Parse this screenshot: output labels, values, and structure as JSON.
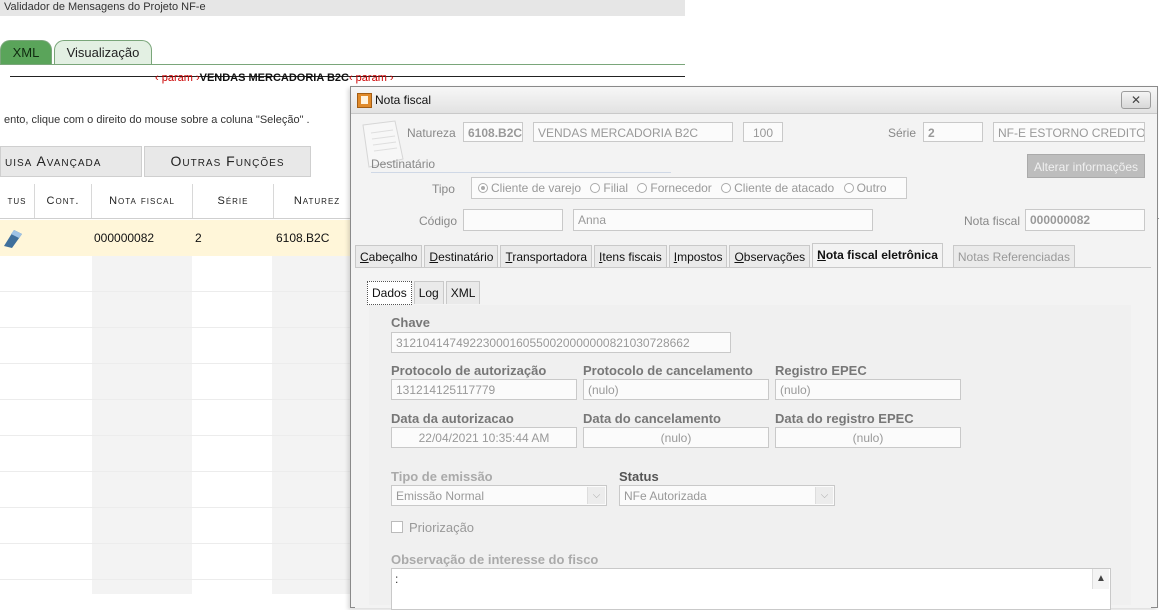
{
  "background": {
    "title": "Validador de Mensagens do Projeto NF-e",
    "tabs": [
      "XML",
      "Visualização"
    ],
    "red_text_prefix": "‹ param ›",
    "red_text_bold": "VENDAS MERCADORIA B2C",
    "red_text_suffix": "‹ param ›",
    "hint": "ento, clique com o direito do mouse sobre a coluna \"Seleção\" .",
    "buttons": {
      "advanced": "uisa Avançada",
      "other": "Outras Funções"
    },
    "columns": [
      "tus",
      "Cont.",
      "Nota fiscal",
      "Série",
      "Naturez"
    ],
    "row": {
      "nota_fiscal": "000000082",
      "serie": "2",
      "natureza": "6108.B2C"
    }
  },
  "dialog": {
    "title": "Nota fiscal",
    "close_symbol": "✕",
    "natureza_label": "Natureza",
    "natureza_code": "6108.B2C",
    "natureza_desc": "VENDAS MERCADORIA B2C",
    "natureza_num": "100",
    "serie_label": "Série",
    "serie_value": "2",
    "serie_desc": "NF-E ESTORNO CREDITO ICM",
    "destinatario_label": "Destinatário",
    "alterar_button": "Alterar informações",
    "tipo_label": "Tipo",
    "tipo_options": [
      "Cliente de varejo",
      "Filial",
      "Fornecedor",
      "Cliente de atacado",
      "Outro"
    ],
    "codigo_label": "Código",
    "codigo_value": "",
    "cliente_nome": "Anna",
    "nota_fiscal_label": "Nota fiscal",
    "nota_fiscal_value": "000000082",
    "tabs": {
      "t1": {
        "u": "C",
        "rest": "abeçalho"
      },
      "t2": {
        "u": "D",
        "rest": "estinatário"
      },
      "t3": {
        "u": "T",
        "rest": "ransportadora"
      },
      "t4": {
        "u": "I",
        "rest": "tens fiscais"
      },
      "t5": {
        "u": "I",
        "rest": "mpostos"
      },
      "t6": {
        "u": "O",
        "rest": "bservações"
      },
      "t7": {
        "u": "N",
        "rest": "ota fiscal eletrônica"
      },
      "t8": {
        "u": "",
        "rest": "Notas Referenciadas"
      }
    },
    "sub_tabs": [
      "Dados",
      "Log",
      "XML"
    ],
    "dados": {
      "chave_label": "Chave",
      "chave_value": "31210414749223000160550020000000821030728662",
      "prot_aut_label": "Protocolo de autorização",
      "prot_aut_value": "131214125117779",
      "prot_canc_label": "Protocolo de cancelamento",
      "prot_canc_value": "(nulo)",
      "reg_epec_label": "Registro EPEC",
      "reg_epec_value": "(nulo)",
      "data_aut_label": "Data da autorizacao",
      "data_aut_value": "22/04/2021 10:35:44 AM",
      "data_canc_label": "Data do cancelamento",
      "data_canc_value": "(nulo)",
      "data_epec_label": "Data do registro EPEC",
      "data_epec_value": "(nulo)",
      "tipo_emissao_label": "Tipo de emissão",
      "tipo_emissao_value": "Emissão Normal",
      "status_label": "Status",
      "status_value": "NFe Autorizada",
      "priorizacao_label": "Priorização",
      "obs_label": "Observação de interesse do fisco",
      "obs_value": ":"
    }
  }
}
